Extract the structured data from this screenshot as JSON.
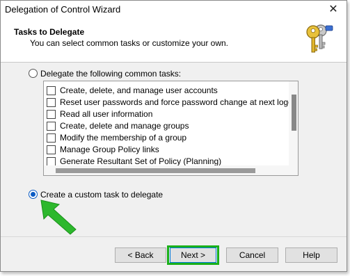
{
  "window": {
    "title": "Delegation of Control Wizard",
    "close_glyph": "✕"
  },
  "header": {
    "title": "Tasks to Delegate",
    "subtitle": "You can select common tasks or customize your own.",
    "icon": "keys-icon"
  },
  "options": {
    "common": {
      "label": "Delegate the following common tasks:",
      "selected": false
    },
    "custom": {
      "label": "Create a custom task to delegate",
      "selected": true
    }
  },
  "tasks": [
    {
      "label": "Create, delete, and manage user accounts",
      "checked": false
    },
    {
      "label": "Reset user passwords and force password change at next logon",
      "checked": false
    },
    {
      "label": "Read all user information",
      "checked": false
    },
    {
      "label": "Create, delete and manage groups",
      "checked": false
    },
    {
      "label": "Modify the membership of a group",
      "checked": false
    },
    {
      "label": "Manage Group Policy links",
      "checked": false
    },
    {
      "label": "Generate Resultant Set of Policy (Planning)",
      "checked": false
    }
  ],
  "buttons": {
    "back": "< Back",
    "next": "Next >",
    "cancel": "Cancel",
    "help": "Help"
  },
  "annotation": {
    "color": "#1ab01a",
    "highlight_target": "next-button"
  }
}
